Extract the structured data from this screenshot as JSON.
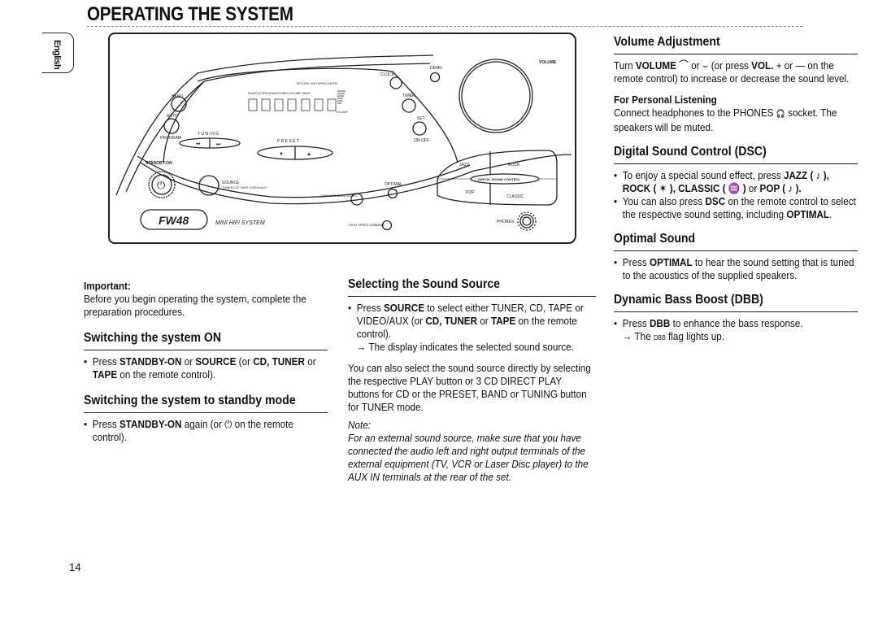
{
  "page": {
    "title": "OPERATING THE SYSTEM",
    "language_tab": "English",
    "page_number": "14"
  },
  "device": {
    "labels": {
      "band": "BAND",
      "auto": "AUTO",
      "program": "PROGRAM",
      "tuning": "T U N I N G",
      "preset": "P R E S E T",
      "standby_on": "STANDBY-ON",
      "source": "SOURCE",
      "source_options": "TUNER-CD-TAPE-VIDEO/AUX",
      "model": "FW48",
      "model_desc": "MINI HIFI SYSTEM",
      "clock": "CLOCK",
      "timer": "TIMER",
      "set": "SET",
      "on_off": "ON-OFF",
      "demo": "DEMO",
      "volume": "VOLUME",
      "jazz": "JAZZ",
      "rock": "ROCK",
      "pop": "POP",
      "classic": "CLASSIC",
      "dsc": "DIGITAL SOUND CONTROL",
      "optimal": "OPTIMAL",
      "dbb": "DYNAMIC BASS BOOST",
      "high_speed": "HIGH SPEED DUBBING",
      "phones": "PHONES",
      "display_volume": "VOLUME",
      "display_flags": "SHUFFLE PROGRAM STEREO FM DBB TIMER",
      "display_flags2": "RECORD HIGH SPEED AM/FM",
      "prev": "⏮",
      "next": "⏭",
      "down": "▼",
      "up": "▲"
    }
  },
  "left_column": {
    "important_label": "Important:",
    "important_text": "Before you begin operating the system, complete the preparation procedures.",
    "switch_on": {
      "heading": "Switching the system ON",
      "bullet": {
        "t1": "Press ",
        "b1": "STANDBY-ON",
        "t2": " or ",
        "b2": "SOURCE",
        "t3": " (or ",
        "b3": "CD, TUNER",
        "t4": " or ",
        "b4": "TAPE",
        "t5": " on the remote control)."
      }
    },
    "standby": {
      "heading": "Switching the system to standby mode",
      "bullet": {
        "t1": "Press ",
        "b1": "STANDBY-ON",
        "t2": " again (or ",
        "icon": "⏻",
        "t3": " on the remote control)."
      }
    }
  },
  "middle_column": {
    "heading": "Selecting the Sound Source",
    "bullet": {
      "t1": "Press ",
      "b1": "SOURCE",
      "t2": " to select either TUNER, CD, TAPE or VIDEO/AUX (or ",
      "b2": "CD, TUNER",
      "t3": " or ",
      "b3": "TAPE",
      "t4": " on the remote control)."
    },
    "result": "→ The display indicates the selected sound source.",
    "paragraph": "You can also select the sound source directly by selecting the respective PLAY button or 3 CD DIRECT PLAY buttons for CD or the PRESET, BAND or TUNING button for TUNER mode.",
    "note_label": "Note:",
    "note_text": "For an external sound source, make sure that you have connected the audio left and right output terminals of the external equipment (TV, VCR or Laser Disc player) to the AUX IN terminals at the rear of the set."
  },
  "right_column": {
    "volume": {
      "heading": "Volume Adjustment",
      "t1": "Turn ",
      "b1": "VOLUME",
      "t2": " ⌒ or ⌣ (or press ",
      "b2": "VOL.",
      "t3": " + or — on the remote control) to increase or decrease the sound level.",
      "personal_heading": "For Personal Listening",
      "personal_text1": "Connect headphones to the PHONES ",
      "headphone_icon": "🎧",
      "personal_text2": " socket. The speakers will be muted."
    },
    "dsc": {
      "heading": "Digital Sound Control  (DSC)",
      "b1": {
        "t1": "To enjoy a special sound effect, press ",
        "jazz": "JAZZ",
        "jazz_icon": "♪",
        "rock": "ROCK",
        "rock_icon": "✶",
        "classic": "CLASSIC",
        "classic_icon": "♒",
        "t_or": " or ",
        "pop": "POP",
        "pop_icon": "♪"
      },
      "b2": {
        "t1": "You can also press ",
        "dsc": "DSC",
        "t2": " on the remote control to select the respective sound setting, including ",
        "optimal": "OPTIMAL",
        "t3": "."
      }
    },
    "optimal": {
      "heading": "Optimal Sound",
      "t1": "Press ",
      "b1": "OPTIMAL",
      "t2": " to hear the sound setting that is tuned to the acoustics of the supplied speakers."
    },
    "dbb": {
      "heading": "Dynamic Bass Boost  (DBB)",
      "t1": "Press ",
      "b1": "DBB",
      "t2": " to enhance the bass response.",
      "result1": "→ The ",
      "flag": "DBB",
      "result2": " flag lights up."
    }
  }
}
